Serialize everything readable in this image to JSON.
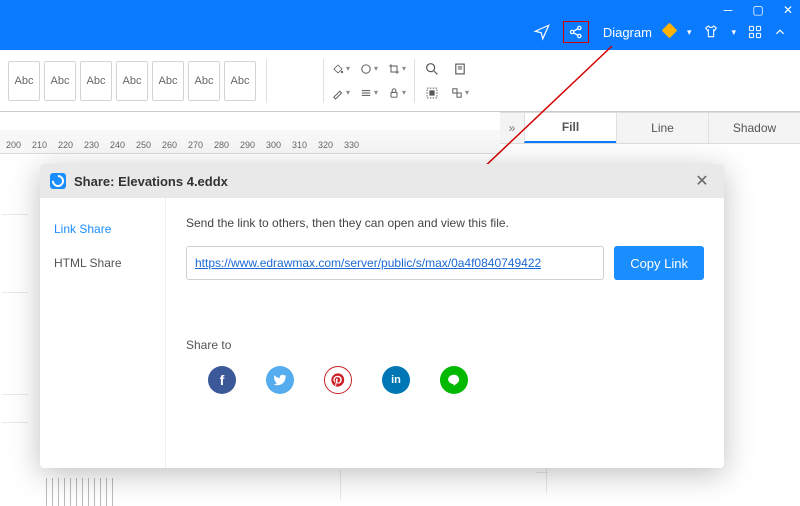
{
  "titlebar": {
    "diagram_label": "Diagram"
  },
  "ribbon": {
    "abc_labels": [
      "Abc",
      "Abc",
      "Abc",
      "Abc",
      "Abc",
      "Abc",
      "Abc"
    ]
  },
  "side_tabs": {
    "fill": "Fill",
    "line": "Line",
    "shadow": "Shadow"
  },
  "ruler_ticks": [
    "200",
    "210",
    "220",
    "230",
    "240",
    "250",
    "260",
    "270",
    "280",
    "290",
    "300",
    "310",
    "320",
    "330"
  ],
  "dialog": {
    "title": "Share: Elevations 4.eddx",
    "tab_link": "Link Share",
    "tab_html": "HTML Share",
    "desc": "Send the link to others, then they can open and view this file.",
    "url": "https://www.edrawmax.com/server/public/s/max/0a4f0840749422",
    "copy": "Copy Link",
    "share_to": "Share to"
  },
  "share": {
    "fb": "f",
    "tw": "t",
    "pin": "p",
    "in": "in",
    "line": "L"
  }
}
